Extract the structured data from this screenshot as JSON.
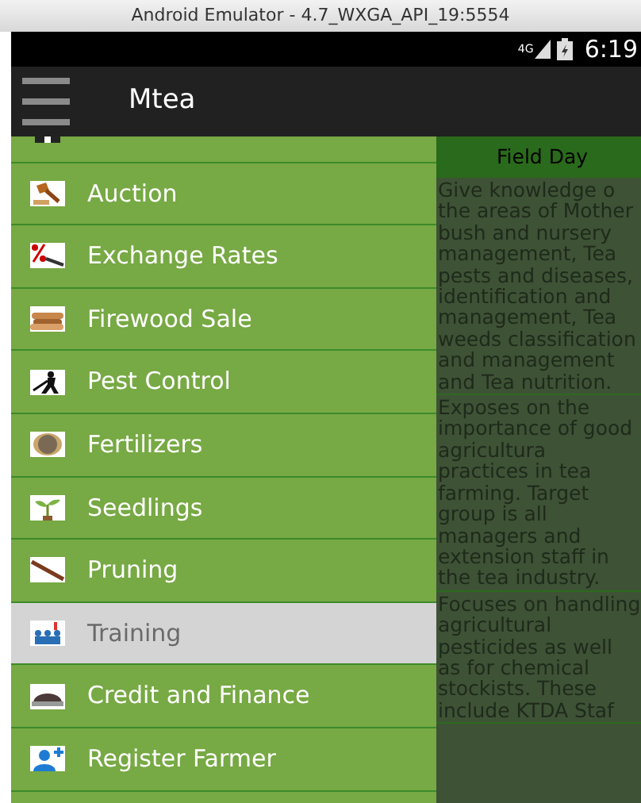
{
  "emulator": {
    "title": "Android Emulator - 4.7_WXGA_API_19:5554"
  },
  "status_bar": {
    "network": "4G",
    "time": "6:19"
  },
  "app_bar": {
    "title": "Mtea"
  },
  "drawer": {
    "items": [
      {
        "selected": false
      },
      {
        "label": "Auction",
        "selected": false
      },
      {
        "label": "Exchange Rates",
        "selected": false
      },
      {
        "label": "Firewood Sale",
        "selected": false
      },
      {
        "label": "Pest Control",
        "selected": false
      },
      {
        "label": "Fertilizers",
        "selected": false
      },
      {
        "label": "Seedlings",
        "selected": false
      },
      {
        "label": "Pruning",
        "selected": false
      },
      {
        "label": "Training",
        "selected": true
      },
      {
        "label": "Credit and Finance",
        "selected": false
      },
      {
        "label": "Register Farmer",
        "selected": false
      }
    ]
  },
  "content": {
    "header": "Field Day",
    "rows": [
      "Give knowledge o the areas of Mother bush and nursery management, Tea pests and diseases, identification and management, Tea weeds classification and management and Tea nutrition.",
      "Exposes on the importance of good agricultura practices in tea farming. Target group is all managers and extension staff in the tea industry.",
      "Focuses on handling agricultural pesticides as well as for chemical stockists. These include KTDA Staf"
    ]
  }
}
